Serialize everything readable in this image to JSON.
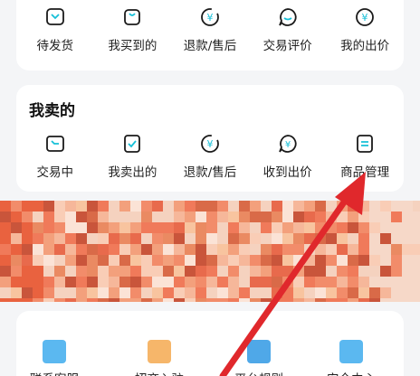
{
  "buy_section": {
    "items": [
      {
        "label": "待发货",
        "icon": "box-icon"
      },
      {
        "label": "我买到的",
        "icon": "bag-icon"
      },
      {
        "label": "退款/售后",
        "icon": "refund-icon"
      },
      {
        "label": "交易评价",
        "icon": "review-icon"
      },
      {
        "label": "我的出价",
        "icon": "bid-icon"
      }
    ]
  },
  "sell_section": {
    "title": "我卖的",
    "items": [
      {
        "label": "交易中",
        "icon": "trade-icon"
      },
      {
        "label": "我卖出的",
        "icon": "sold-icon"
      },
      {
        "label": "退款/售后",
        "icon": "refund-icon"
      },
      {
        "label": "收到出价",
        "icon": "offer-icon"
      },
      {
        "label": "商品管理",
        "icon": "clipboard-icon"
      }
    ]
  },
  "services": {
    "items": [
      {
        "label": "联系客服",
        "color": "#5bb8f0"
      },
      {
        "label": "招商入驻",
        "color": "#f6b66a"
      },
      {
        "label": "平台规则",
        "color": "#4fa8e8"
      },
      {
        "label": "安全中心",
        "color": "#5bb8f0"
      }
    ]
  },
  "colors": {
    "accent_icon": "#1a1a1a",
    "annotation_arrow": "#e0282c"
  }
}
